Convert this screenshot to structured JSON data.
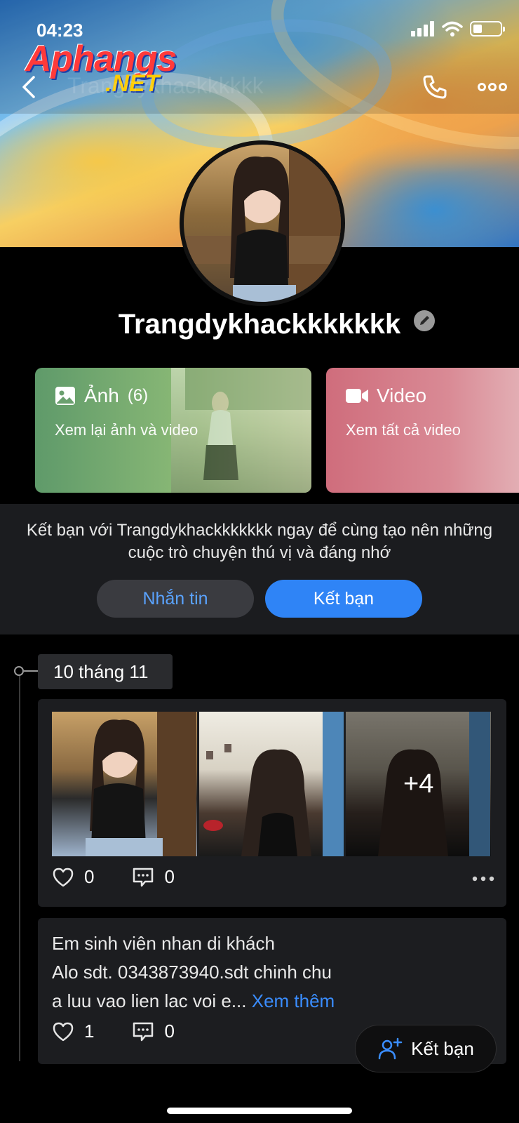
{
  "status_bar": {
    "time": "04:23"
  },
  "watermark": {
    "brand": "Aphangs",
    "suffix": ".NET"
  },
  "profile": {
    "name": "Trangdykhackkkkkkk",
    "ghost_header_name": "Trangdykhackkkkkk"
  },
  "cards": {
    "photos": {
      "title": "Ảnh",
      "count": "(6)",
      "subtitle": "Xem lại ảnh và video"
    },
    "video": {
      "title": "Video",
      "subtitle": "Xem tất cả video"
    }
  },
  "friend_panel": {
    "message": "Kết bạn với Trangdykhackkkkkkk ngay để cùng tạo nên những cuộc trò chuyện thú vị và đáng nhớ",
    "message_button": "Nhắn tin",
    "add_button": "Kết bạn"
  },
  "timeline": {
    "date": "10 tháng 11",
    "posts": [
      {
        "extra_photos": "+4",
        "likes": "0",
        "comments": "0"
      },
      {
        "text_line1": "Em sinh viên nhan di khách",
        "text_line2": "Alo sdt. 0343873940.sdt chinh chu",
        "text_line3": "a luu vao lien lac voi e...",
        "see_more": "Xem thêm",
        "likes": "1",
        "comments": "0"
      }
    ]
  },
  "floating_button": {
    "label": "Kết bạn"
  },
  "colors": {
    "accent": "#2f84f6",
    "link": "#3a8dff",
    "panel": "#1b1c1f"
  }
}
